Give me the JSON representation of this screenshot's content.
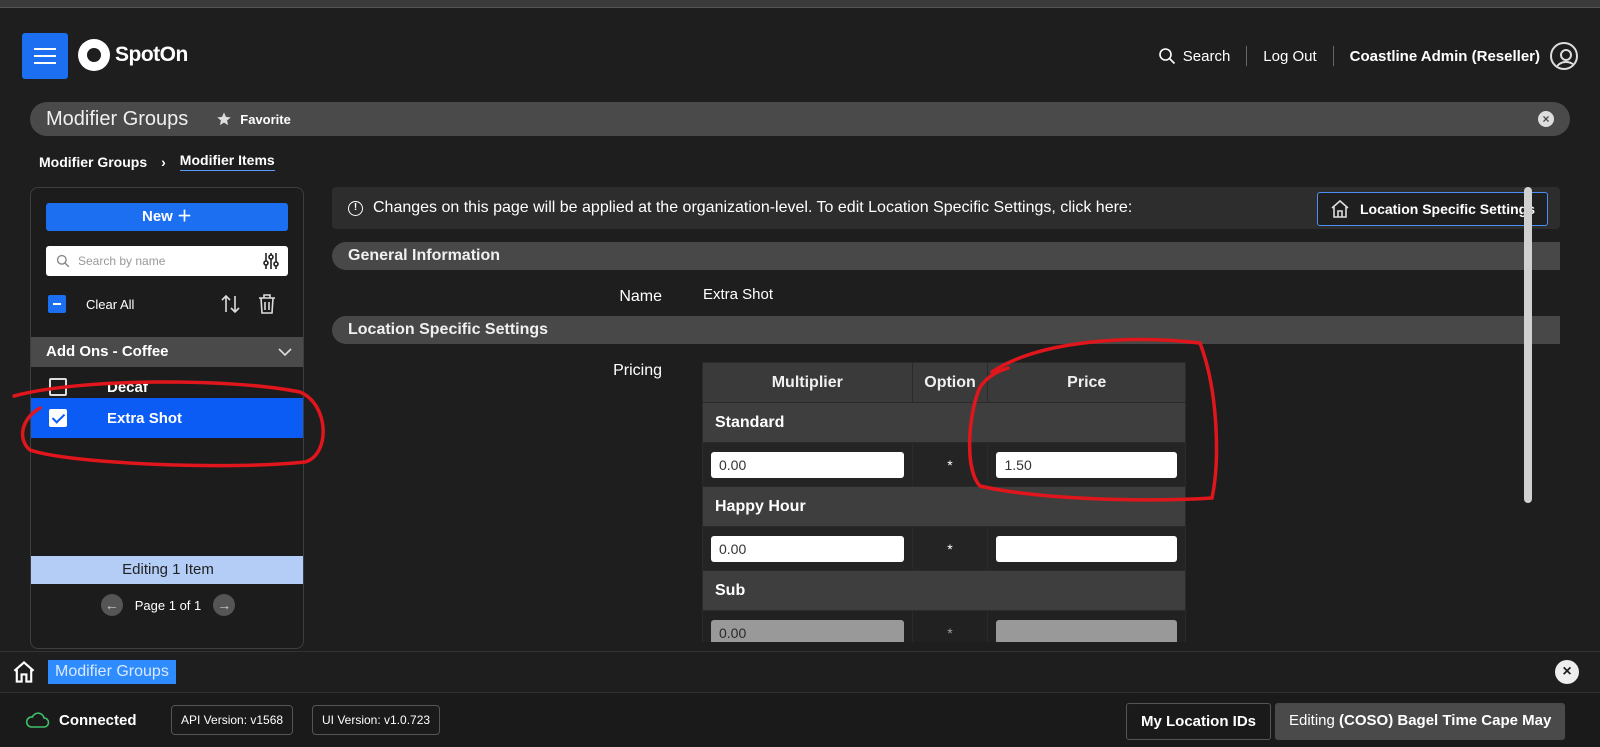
{
  "header": {
    "logo_text": "SpotOn",
    "search_label": "Search",
    "logout_label": "Log Out",
    "user_name": "Coastline Admin (Reseller)"
  },
  "tabbar": {
    "title": "Modifier Groups",
    "favorite_label": "Favorite",
    "close_glyph": "×"
  },
  "breadcrumb": {
    "items": [
      "Modifier Groups",
      "Modifier Items"
    ],
    "separator": "›"
  },
  "left_panel": {
    "new_label": "New ＋",
    "search_placeholder": "Search by name",
    "clear_all_label": "Clear All",
    "group_name": "Add Ons - Coffee",
    "items": [
      {
        "label": "Decaf",
        "checked": false
      },
      {
        "label": "Extra Shot",
        "checked": true
      }
    ],
    "editing_label": "Editing 1 Item",
    "pagination": {
      "label": "Page 1 of 1",
      "prev_glyph": "←",
      "next_glyph": "→"
    }
  },
  "main": {
    "info_text": "Changes on this page will be applied at the organization-level. To edit Location Specific Settings, click here:",
    "info_glyph": "!",
    "location_button_label": "Location Specific Settings",
    "general_section_title": "General Information",
    "name_label": "Name",
    "name_value": "Extra Shot",
    "location_section_title": "Location Specific Settings",
    "pricing_label": "Pricing",
    "pricing_table": {
      "columns": [
        "Multiplier",
        "Option",
        "Price"
      ],
      "groups": [
        {
          "name": "Standard",
          "multiplier": "0.00",
          "option": "*",
          "price": "1.50"
        },
        {
          "name": "Happy Hour",
          "multiplier": "0.00",
          "option": "*",
          "price": ""
        },
        {
          "name": "Sub",
          "multiplier": "0.00",
          "option": "*",
          "price": ""
        }
      ]
    }
  },
  "taskbar": {
    "active_tab": "Modifier Groups",
    "close_glyph": "×"
  },
  "statusbar": {
    "connection_label": "Connected",
    "api_version": "API Version: v1568",
    "ui_version": "UI Version: v1.0.723",
    "my_location_ids_label": "My Location IDs",
    "editing_prefix": "Editing ",
    "editing_location": "(COSO) Bagel Time Cape May"
  },
  "colors": {
    "accent": "#1d6ff2",
    "selected_row": "#0b5cf5",
    "background": "#1e1e1e",
    "annotation": "#e0161c"
  },
  "icons": {
    "menu": "hamburger-icon",
    "search": "search-icon",
    "user": "user-circle-icon",
    "favorite": "star-icon",
    "filter": "sliders-icon",
    "sort": "sort-arrows-icon",
    "delete": "trash-icon",
    "home": "home-icon",
    "cloud": "cloud-icon"
  }
}
